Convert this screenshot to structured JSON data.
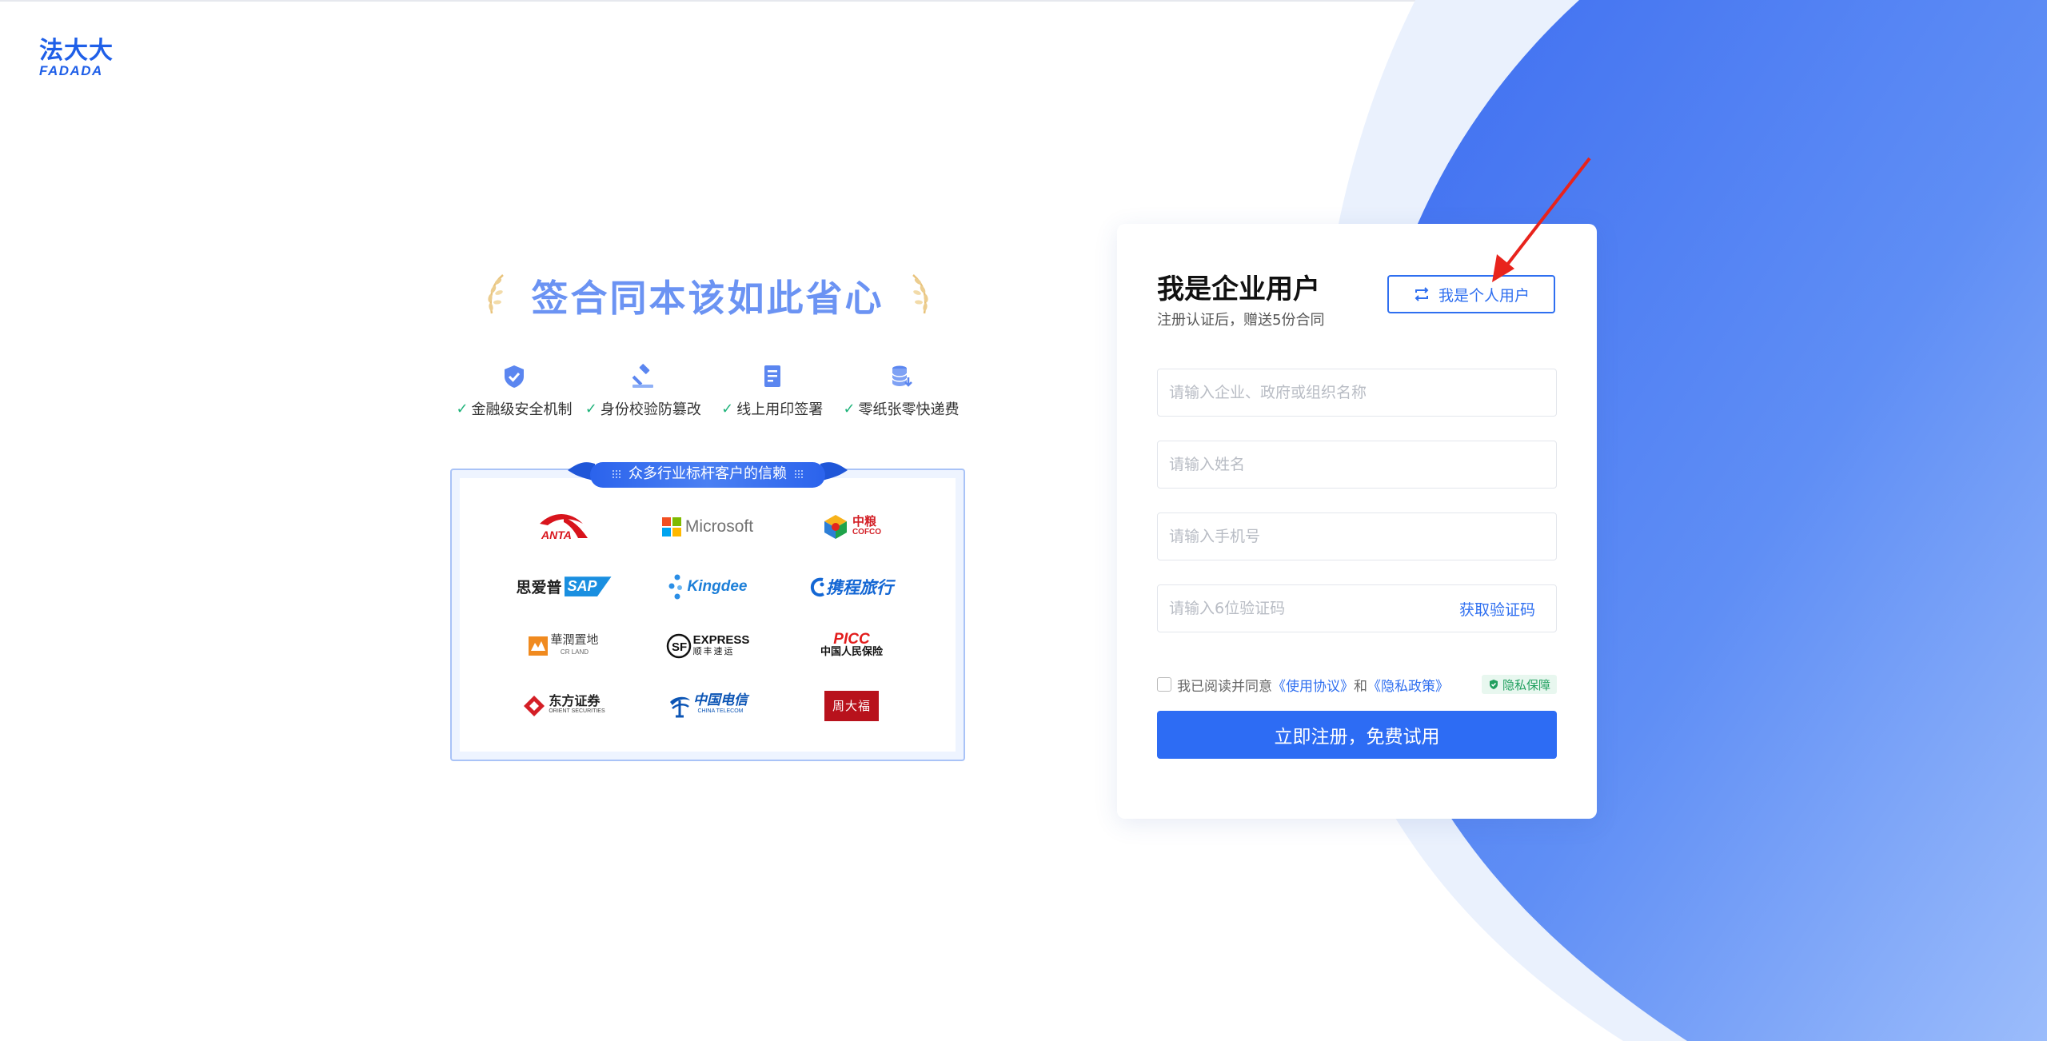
{
  "logo": {
    "cn": "法大大",
    "en": "FADADA"
  },
  "promo": {
    "slogan": "签合同本该如此省心",
    "features": [
      {
        "icon": "shield-icon",
        "label": "金融级安全机制"
      },
      {
        "icon": "gavel-icon",
        "label": "身份校验防篡改"
      },
      {
        "icon": "document-icon",
        "label": "线上用印签署"
      },
      {
        "icon": "database-icon",
        "label": "零纸张零快递费"
      }
    ],
    "trust_title": "众多行业标杆客户的信赖",
    "clients": [
      {
        "id": "anta",
        "text": "ANTA"
      },
      {
        "id": "microsoft",
        "text": "Microsoft"
      },
      {
        "id": "cofco",
        "text": "中粮",
        "sub": "COFCO"
      },
      {
        "id": "sap",
        "text": "思爱普",
        "sub": "SAP"
      },
      {
        "id": "kingdee",
        "text": "Kingdee"
      },
      {
        "id": "ctrip",
        "text": "携程旅行"
      },
      {
        "id": "crland",
        "text": "華潤置地",
        "sub": "CR LAND"
      },
      {
        "id": "sf",
        "text": "EXPRESS",
        "sub": "顺丰速运"
      },
      {
        "id": "picc",
        "text": "PICC",
        "sub": "中国人民保险"
      },
      {
        "id": "orient",
        "text": "东方证券",
        "sub": "ORIENT SECURITIES"
      },
      {
        "id": "telecom",
        "text": "中国电信",
        "sub": "CHINA TELECOM"
      },
      {
        "id": "chowtaiseng",
        "text": "周大福"
      }
    ]
  },
  "form": {
    "title": "我是企业用户",
    "subtitle": "注册认证后，赠送5份合同",
    "switch_label": "我是个人用户",
    "company_placeholder": "请输入企业、政府或组织名称",
    "name_placeholder": "请输入姓名",
    "phone_placeholder": "请输入手机号",
    "code_placeholder": "请输入6位验证码",
    "get_code_label": "获取验证码",
    "agree_prefix": "我已阅读并同意",
    "terms_link": "《使用协议》",
    "agree_and": "和",
    "privacy_link": "《隐私政策》",
    "privacy_badge": "隐私保障",
    "submit_label": "立即注册，免费试用"
  },
  "colors": {
    "brand": "#1f5fe8",
    "primary_button": "#2d6cf4",
    "check_green": "#1fb37a",
    "annotation_red": "#e8231c"
  }
}
